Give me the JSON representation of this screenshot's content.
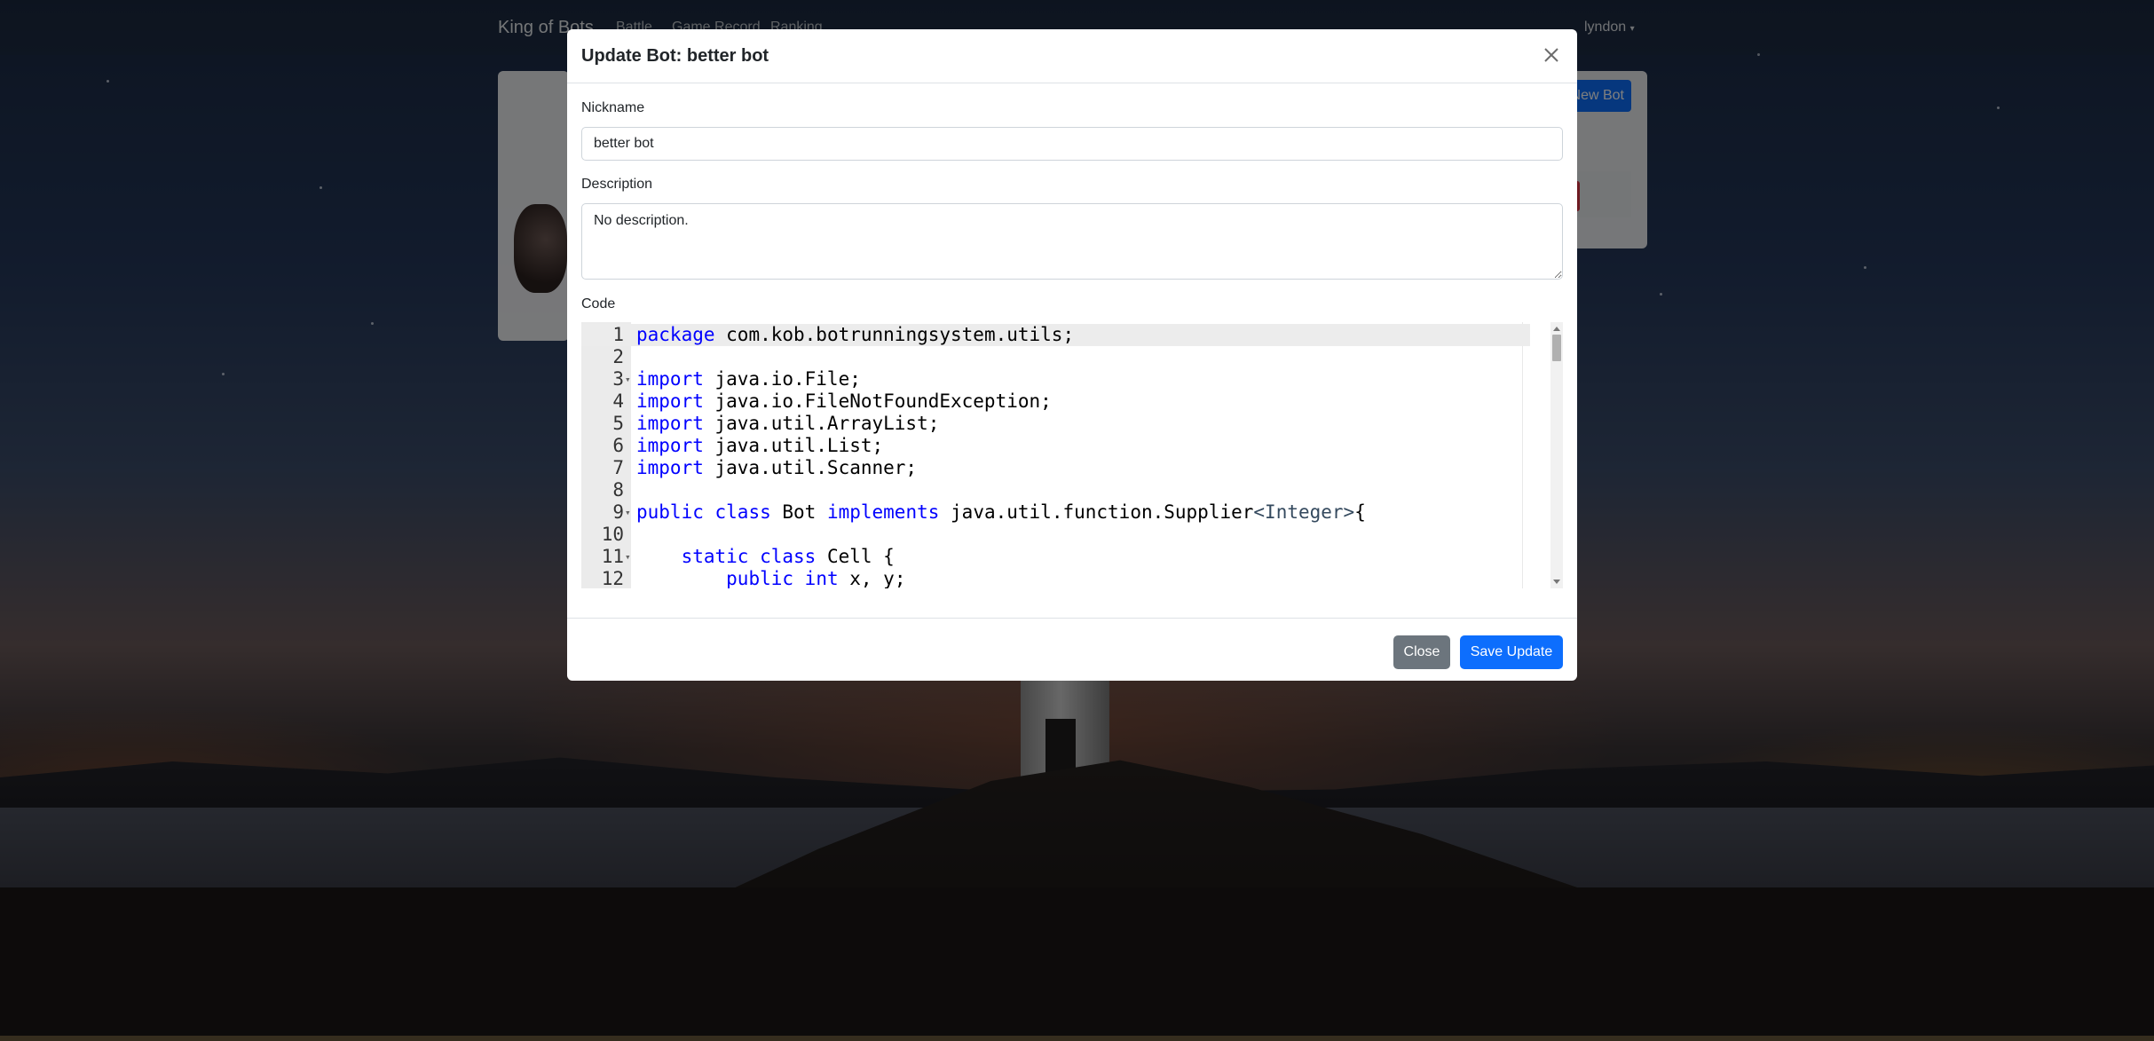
{
  "navbar": {
    "brand": "King of Bots",
    "links": [
      "Battle",
      "Game Record",
      "Ranking"
    ],
    "user": "lyndon"
  },
  "page": {
    "new_bot_label": "New Bot"
  },
  "modal": {
    "title": "Update Bot: better bot",
    "nickname_label": "Nickname",
    "nickname_value": "better bot",
    "description_label": "Description",
    "description_value": "No description.",
    "code_label": "Code",
    "close_label": "Close",
    "save_label": "Save Update"
  },
  "code": {
    "line_numbers": [
      "1",
      "2",
      "3",
      "4",
      "5",
      "6",
      "7",
      "8",
      "9",
      "10",
      "11",
      "12"
    ],
    "lines": [
      "package com.kob.botrunningsystem.utils;",
      "",
      "import java.io.File;",
      "import java.io.FileNotFoundException;",
      "import java.util.ArrayList;",
      "import java.util.List;",
      "import java.util.Scanner;",
      "",
      "public class Bot implements java.util.function.Supplier<Integer>{",
      "",
      "    static class Cell {",
      "        public int x, y;"
    ]
  },
  "colors": {
    "primary": "#0d6efd",
    "secondary": "#6c757d",
    "keyword": "#0000ff"
  }
}
